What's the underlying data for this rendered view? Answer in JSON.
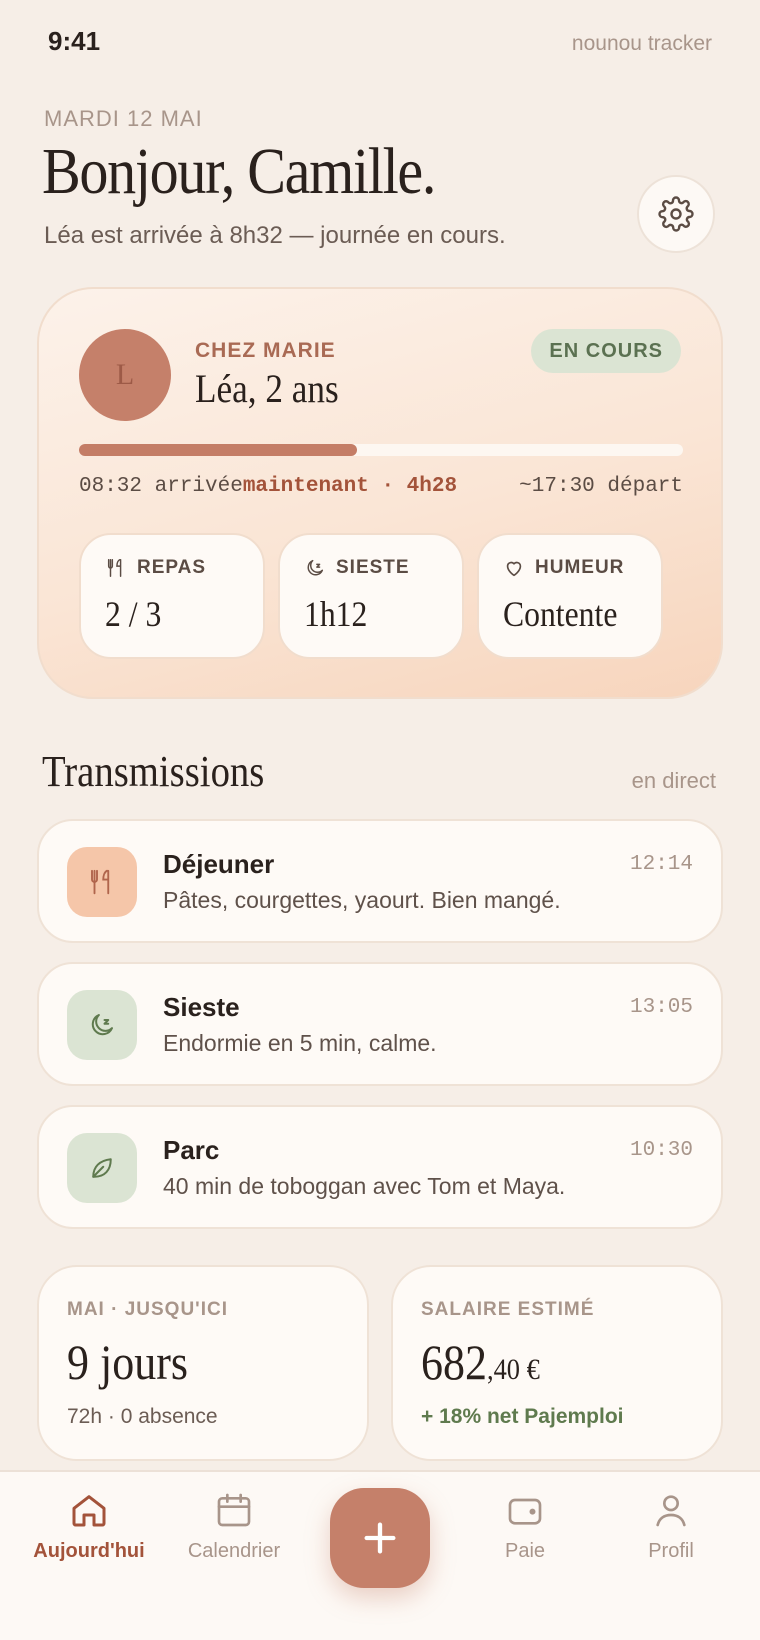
{
  "status_bar": {
    "time": "9:41",
    "app_name": "nounou tracker"
  },
  "header": {
    "date": "MARDI 12 MAI",
    "greeting": "Bonjour, Camille.",
    "subtitle": "Léa est arrivée à 8h32 — journée en cours."
  },
  "child_card": {
    "avatar_initial": "L",
    "location_label": "CHEZ MARIE",
    "child_name": "Léa, 2 ans",
    "status_badge": "EN COURS",
    "progress_fraction": 0.46,
    "arrival": "08:32 arrivée",
    "now": "maintenant · 4h28",
    "departure": "~17:30 départ",
    "stats": [
      {
        "icon": "cutlery-icon",
        "label": "REPAS",
        "value": "2 / 3"
      },
      {
        "icon": "moon-icon",
        "label": "SIESTE",
        "value": "1h12"
      },
      {
        "icon": "heart-icon",
        "label": "HUMEUR",
        "value": "Contente"
      }
    ]
  },
  "transmissions": {
    "title": "Transmissions",
    "link": "en direct",
    "items": [
      {
        "icon": "cutlery-icon",
        "title": "Déjeuner",
        "time": "12:14",
        "description": "Pâtes, courgettes, yaourt. Bien mangé.",
        "color": "#f5c6a9"
      },
      {
        "icon": "moon-icon",
        "title": "Sieste",
        "time": "13:05",
        "description": "Endormie en 5 min, calme.",
        "color": "#dbe4d3"
      },
      {
        "icon": "leaf-icon",
        "title": "Parc",
        "time": "10:30",
        "description": "40 min de toboggan avec Tom et Maya.",
        "color": "#dbe4d3"
      }
    ]
  },
  "summary": {
    "days": {
      "label": "MAI · JUSQU'ICI",
      "value": "9 jours",
      "sub": "72h · 0 absence"
    },
    "salary": {
      "label": "SALAIRE ESTIMÉ",
      "value_main": "682",
      "value_decimal": ",40 €",
      "sub": "+ 18% net Pajemploi"
    }
  },
  "nav": {
    "items": [
      {
        "icon": "home-icon",
        "label": "Aujourd'hui",
        "active": true
      },
      {
        "icon": "calendar-icon",
        "label": "Calendrier",
        "active": false
      },
      {
        "icon": "plus-icon",
        "label": "",
        "active": false
      },
      {
        "icon": "wallet-icon",
        "label": "Paie",
        "active": false
      },
      {
        "icon": "user-icon",
        "label": "Profil",
        "active": false
      }
    ]
  },
  "colors": {
    "background": "#f6eee7",
    "accent": "#c5806a",
    "accent_text": "#a3533a",
    "green": "#5f7a4e"
  }
}
